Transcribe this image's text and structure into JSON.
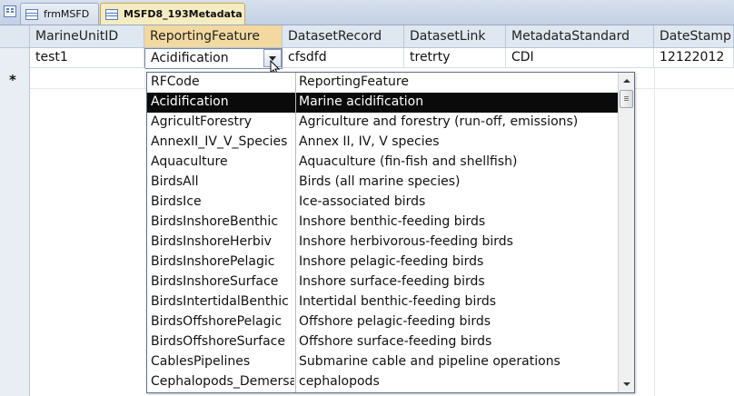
{
  "tabs": [
    {
      "label": "frmMSFD",
      "icon": "form-icon",
      "active": false
    },
    {
      "label": "MSFD8_193Metadata",
      "icon": "table-icon",
      "active": true
    }
  ],
  "columns": [
    "MarineUnitID",
    "ReportingFeature",
    "DatasetRecord",
    "DatasetLink",
    "MetadataStandard",
    "DateStamp"
  ],
  "rows": [
    [
      "test1",
      "Acidification",
      "cfsdfd",
      "tretrty",
      "CDI",
      "12122012"
    ]
  ],
  "new_record_marker": "*",
  "dropdown": {
    "headers": [
      "RFCode",
      "ReportingFeature"
    ],
    "items": [
      [
        "Acidification",
        "Marine acidification"
      ],
      [
        "AgricultForestry",
        "Agriculture and forestry (run-off,  emissions)"
      ],
      [
        "AnnexII_IV_V_Species",
        "Annex II, IV, V species"
      ],
      [
        "Aquaculture",
        "Aquaculture (fin-fish and shellfish)"
      ],
      [
        "BirdsAll",
        "Birds (all marine species)"
      ],
      [
        "BirdsIce",
        "Ice-associated birds"
      ],
      [
        "BirdsInshoreBenthic",
        "Inshore benthic-feeding birds"
      ],
      [
        "BirdsInshoreHerbiv",
        "Inshore herbivorous-feeding birds"
      ],
      [
        "BirdsInshorePelagic",
        "Inshore pelagic-feeding birds"
      ],
      [
        "BirdsInshoreSurface",
        "Inshore surface-feeding birds"
      ],
      [
        "BirdsIntertidalBenthic",
        "Intertidal benthic-feeding birds"
      ],
      [
        "BirdsOffshorePelagic",
        "Offshore pelagic-feeding birds"
      ],
      [
        "BirdsOffshoreSurface",
        "Offshore surface-feeding birds"
      ],
      [
        "CablesPipelines",
        "Submarine cable and pipeline operations"
      ],
      [
        "Cephalopods_Demersal",
        "cephalopods"
      ]
    ],
    "selected_index": 0
  },
  "colors": {
    "selection": "#0a0a0a",
    "header_bg": "#dfe7f1",
    "active_tab": "#f6ecc2"
  }
}
